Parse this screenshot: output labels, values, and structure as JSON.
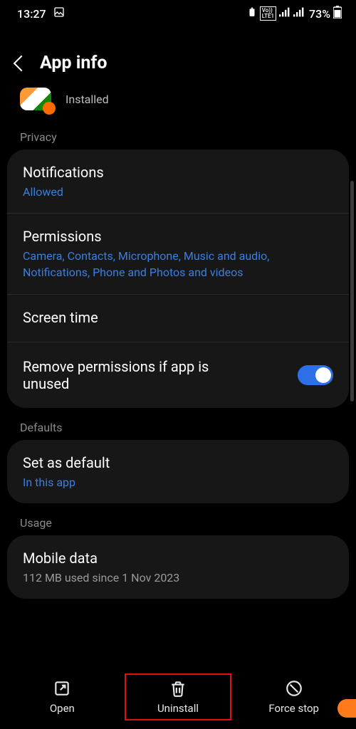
{
  "status": {
    "time": "13:27",
    "battery_pct": "73%"
  },
  "header": {
    "title": "App info"
  },
  "app": {
    "status": "Installed"
  },
  "sections": {
    "privacy_label": "Privacy",
    "defaults_label": "Defaults",
    "usage_label": "Usage"
  },
  "privacy": {
    "notifications": {
      "title": "Notifications",
      "value": "Allowed"
    },
    "permissions": {
      "title": "Permissions",
      "value": "Camera, Contacts, Microphone, Music and audio, Notifications, Phone and Photos and videos"
    },
    "screen_time": {
      "title": "Screen time"
    },
    "remove_unused": {
      "title": "Remove permissions if app is unused",
      "enabled": true
    }
  },
  "defaults": {
    "set_default": {
      "title": "Set as default",
      "value": "In this app"
    }
  },
  "usage": {
    "mobile_data": {
      "title": "Mobile data",
      "value": "112 MB used since 1 Nov 2023"
    }
  },
  "bottom": {
    "open": "Open",
    "uninstall": "Uninstall",
    "force_stop": "Force stop"
  }
}
